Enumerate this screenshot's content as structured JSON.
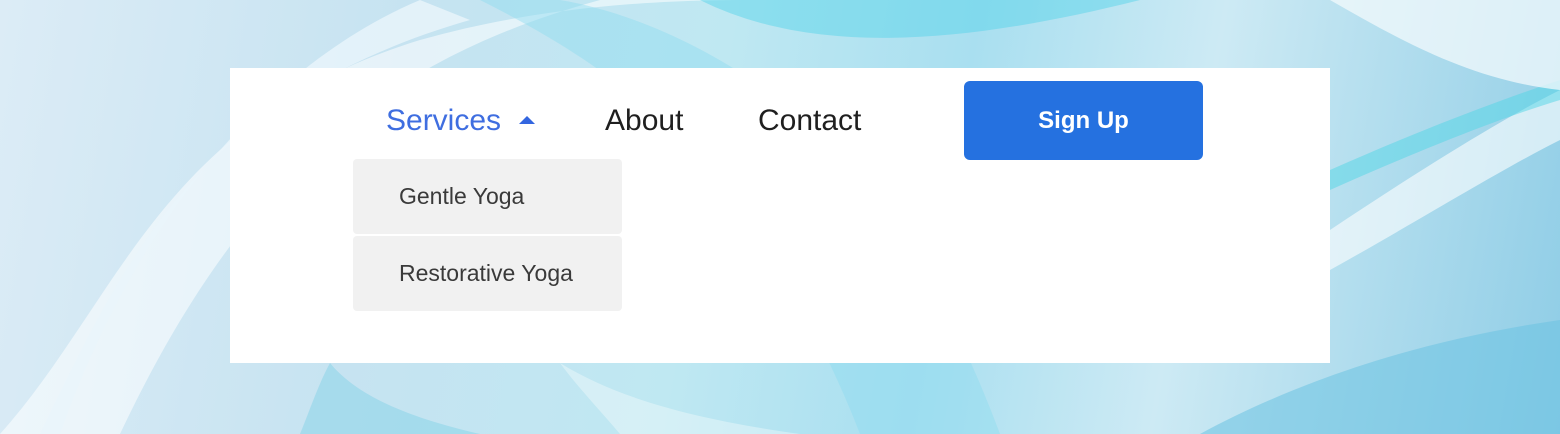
{
  "nav": {
    "services_label": "Services",
    "about_label": "About",
    "contact_label": "Contact",
    "signup_label": "Sign Up",
    "services_caret_icon": "caret-up-icon"
  },
  "dropdown": {
    "items": [
      {
        "label": "Gentle Yoga"
      },
      {
        "label": "Restorative Yoga"
      }
    ]
  },
  "colors": {
    "accent": "#2571e0",
    "active_link": "#3f6ee0",
    "text": "#1f1f1f",
    "dropdown_bg": "#f1f1f1",
    "panel_bg": "#ffffff"
  }
}
